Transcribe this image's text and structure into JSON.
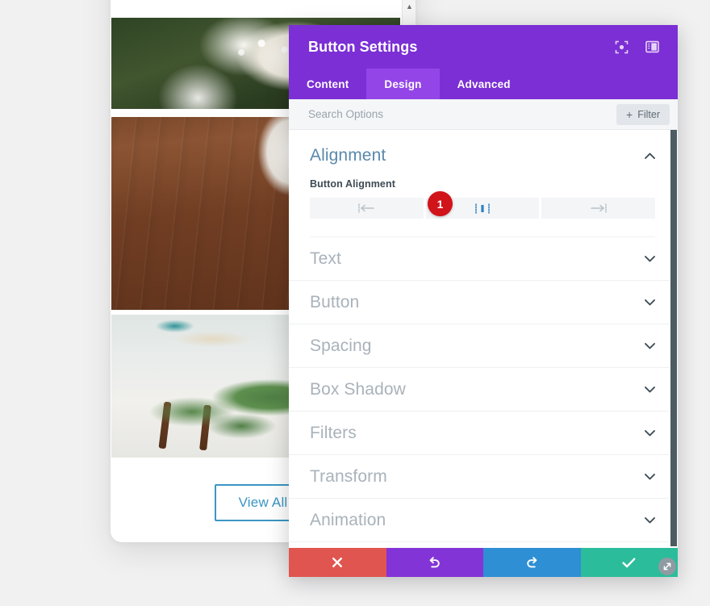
{
  "background_page": {
    "photos": [
      {
        "alt": "bride holding white flower bouquet"
      },
      {
        "alt": "bride feet in black heels on wooden floor"
      },
      {
        "alt": "green eucalyptus garland table decor"
      }
    ],
    "view_all_label": "View All",
    "scroll_up_icon": "scroll-up-arrow-icon"
  },
  "modal": {
    "title": "Button Settings",
    "header_icons": [
      {
        "name": "focus-target-icon"
      },
      {
        "name": "panel-layout-icon"
      }
    ],
    "tabs": [
      {
        "label": "Content",
        "active": false
      },
      {
        "label": "Design",
        "active": true
      },
      {
        "label": "Advanced",
        "active": false
      }
    ],
    "search": {
      "placeholder": "Search Options",
      "value": ""
    },
    "filter_button": {
      "label": "Filter",
      "plus_icon": "plus-icon"
    },
    "open_section": {
      "title": "Alignment",
      "chevron_icon": "chevron-up-icon",
      "field_label": "Button Alignment",
      "options": [
        {
          "name": "align-left",
          "icon": "align-left-icon",
          "active": false
        },
        {
          "name": "align-center",
          "icon": "align-center-icon",
          "active": true
        },
        {
          "name": "align-right",
          "icon": "align-right-icon",
          "active": false
        }
      ],
      "badge": "1"
    },
    "collapsed_sections": [
      {
        "label": "Text",
        "chevron_icon": "chevron-down-icon"
      },
      {
        "label": "Button",
        "chevron_icon": "chevron-down-icon"
      },
      {
        "label": "Spacing",
        "chevron_icon": "chevron-down-icon"
      },
      {
        "label": "Box Shadow",
        "chevron_icon": "chevron-down-icon"
      },
      {
        "label": "Filters",
        "chevron_icon": "chevron-down-icon"
      },
      {
        "label": "Transform",
        "chevron_icon": "chevron-down-icon"
      },
      {
        "label": "Animation",
        "chevron_icon": "chevron-down-icon"
      }
    ],
    "footer_buttons": [
      {
        "name": "cancel-button",
        "icon": "close-x-icon",
        "color": "#e0554f"
      },
      {
        "name": "undo-button",
        "icon": "undo-icon",
        "color": "#8334d6"
      },
      {
        "name": "redo-button",
        "icon": "redo-icon",
        "color": "#2e8fd4"
      },
      {
        "name": "save-button",
        "icon": "checkmark-icon",
        "color": "#2bbd9b"
      }
    ],
    "resize_handle_icon": "resize-diagonal-icon",
    "colors": {
      "header_purple": "#7b2fd4",
      "tab_active_purple": "#9345e8",
      "accent_blue": "#5a89ab",
      "badge_red": "#d1131a"
    }
  }
}
